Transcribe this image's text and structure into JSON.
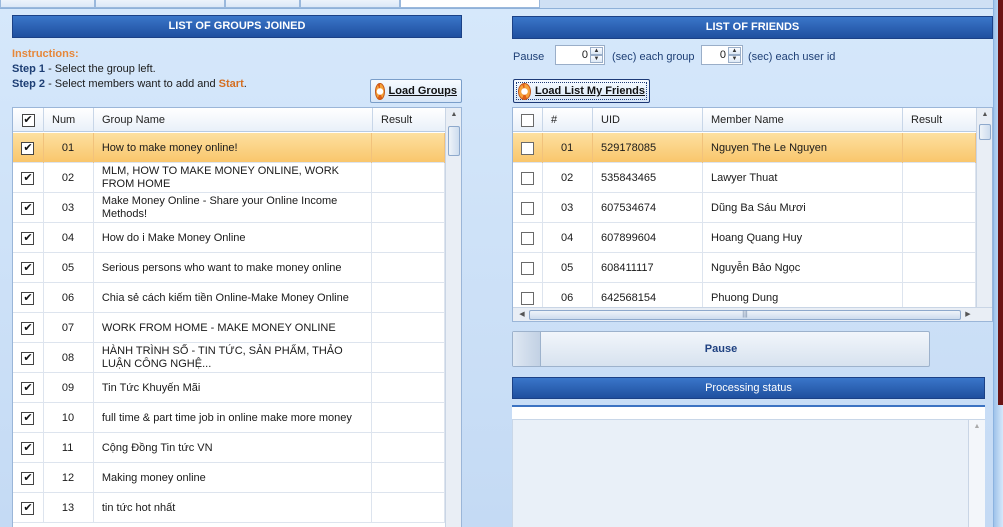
{
  "groups_panel": {
    "title": "LIST OF GROUPS JOINED",
    "instructions_heading": "Instructions:",
    "step1_label": "Step 1",
    "step1_text": " - Select the group left.",
    "step2_label": "Step 2",
    "step2_text": " - Select members want to add and ",
    "step2_start": "Start",
    "step2_end": ".",
    "load_button": "Load Groups",
    "columns": [
      "Num",
      "Group Name",
      "Result"
    ],
    "rows": [
      {
        "num": "01",
        "name": "How to make money online!",
        "result": "",
        "checked": true,
        "selected": true
      },
      {
        "num": "02",
        "name": "MLM, HOW TO MAKE MONEY ONLINE, WORK FROM HOME",
        "result": "",
        "checked": true,
        "selected": false
      },
      {
        "num": "03",
        "name": "Make Money Online - Share your Online Income Methods!",
        "result": "",
        "checked": true,
        "selected": false
      },
      {
        "num": "04",
        "name": "How do i Make Money Online",
        "result": "",
        "checked": true,
        "selected": false
      },
      {
        "num": "05",
        "name": "Serious persons who want to make money online",
        "result": "",
        "checked": true,
        "selected": false
      },
      {
        "num": "06",
        "name": "Chia sẻ cách kiếm tiền Online-Make Money Online",
        "result": "",
        "checked": true,
        "selected": false
      },
      {
        "num": "07",
        "name": "WORK FROM HOME - MAKE MONEY ONLINE",
        "result": "",
        "checked": true,
        "selected": false
      },
      {
        "num": "08",
        "name": "HÀNH TRÌNH SỐ - TIN TỨC, SẢN PHẨM, THẢO LUẬN CÔNG NGHỆ...",
        "result": "",
        "checked": true,
        "selected": false
      },
      {
        "num": "09",
        "name": "Tin Tức Khuyến Mãi",
        "result": "",
        "checked": true,
        "selected": false
      },
      {
        "num": "10",
        "name": "full time & part time job in online make more money",
        "result": "",
        "checked": true,
        "selected": false
      },
      {
        "num": "11",
        "name": "Cộng Đồng Tin tức VN",
        "result": "",
        "checked": true,
        "selected": false
      },
      {
        "num": "12",
        "name": "Making money online",
        "result": "",
        "checked": true,
        "selected": false
      },
      {
        "num": "13",
        "name": "tin tức hot nhất",
        "result": "",
        "checked": true,
        "selected": false
      }
    ]
  },
  "friends_panel": {
    "title": "LIST OF FRIENDS",
    "pause_label": "Pause",
    "pause_group_value": "0",
    "each_group_label": "(sec) each group",
    "pause_user_value": "0",
    "each_user_label": "(sec) each user id",
    "load_button": "Load List My Friends",
    "columns": [
      "#",
      "UID",
      "Member Name",
      "Result"
    ],
    "rows": [
      {
        "num": "01",
        "uid": "529178085",
        "name": "Nguyen The Le Nguyen",
        "result": "",
        "checked": false,
        "selected": true
      },
      {
        "num": "02",
        "uid": "535843465",
        "name": "Lawyer Thuat",
        "result": "",
        "checked": false,
        "selected": false
      },
      {
        "num": "03",
        "uid": "607534674",
        "name": "Dũng Ba Sáu Mươi",
        "result": "",
        "checked": false,
        "selected": false
      },
      {
        "num": "04",
        "uid": "607899604",
        "name": "Hoang Quang Huy",
        "result": "",
        "checked": false,
        "selected": false
      },
      {
        "num": "05",
        "uid": "608411117",
        "name": "Nguyễn Bảo Ngọc",
        "result": "",
        "checked": false,
        "selected": false
      },
      {
        "num": "06",
        "uid": "642568154",
        "name": "Phuong Dung",
        "result": "",
        "checked": false,
        "selected": false
      }
    ],
    "pause_button": "Pause",
    "status_title": "Processing status"
  },
  "icons": {
    "load_groups": "refresh-icon",
    "load_friends": "refresh-icon",
    "header_checkbox_groups": "checkbox-checked",
    "header_checkbox_friends": "checkbox-unchecked"
  },
  "colors": {
    "title_bar": "#2a5fb3",
    "selected_row": "#f9c66c",
    "instructions_heading": "#e6873a",
    "start_text": "#d46f22"
  }
}
